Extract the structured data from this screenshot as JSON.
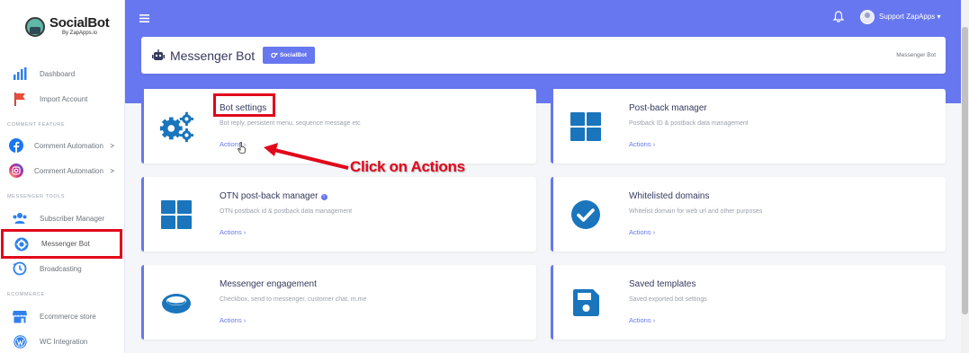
{
  "app": {
    "logo_title": "SocialBot",
    "logo_sub": "By ZapApps.io"
  },
  "sidebar": {
    "items": [
      {
        "label": "Dashboard",
        "icon": "bar-chart-icon"
      },
      {
        "label": "Import Account",
        "icon": "flag-icon"
      },
      {
        "label": "Comment Automation",
        "icon": "facebook-icon",
        "chevron": ">"
      },
      {
        "label": "Comment Automation",
        "icon": "instagram-icon",
        "chevron": ">"
      },
      {
        "label": "Subscriber Manager",
        "icon": "users-icon"
      },
      {
        "label": "Messenger Bot",
        "icon": "gear-icon"
      },
      {
        "label": "Broadcasting",
        "icon": "history-icon"
      },
      {
        "label": "Ecommerce store",
        "icon": "store-icon"
      },
      {
        "label": "WC Integration",
        "icon": "wordpress-icon"
      }
    ],
    "sections": {
      "comment": "COMMENT FEATURE",
      "messenger": "MESSENGER TOOLS",
      "ecommerce": "ECOMMERCE"
    }
  },
  "topbar": {
    "user": "Support ZapApps ▾"
  },
  "header": {
    "title": "Messenger Bot",
    "badge": "SocialBot",
    "breadcrumb": "Messenger Bot"
  },
  "cards": [
    {
      "title": "Bot settings",
      "desc": "Bot reply, persistent menu, sequence message etc",
      "action": "Actions",
      "icon": "gears-icon"
    },
    {
      "title": "Post-back manager",
      "desc": "Postback ID & postback data management",
      "action": "Actions",
      "icon": "grid-icon"
    },
    {
      "title": "OTN post-back manager",
      "desc": "OTN postback id & postback data management",
      "action": "Actions",
      "icon": "grid-icon"
    },
    {
      "title": "Whitelisted domains",
      "desc": "Whitelist domain for web url and other purposes",
      "action": "Actions",
      "icon": "check-circle-icon"
    },
    {
      "title": "Messenger engagement",
      "desc": "Checkbox, send to messenger, customer chat, m.me",
      "action": "Actions",
      "icon": "ring-icon"
    },
    {
      "title": "Saved templates",
      "desc": "Saved exported bot settings",
      "action": "Actions",
      "icon": "save-icon"
    }
  ],
  "annotation": {
    "text": "Click on Actions"
  },
  "colors": {
    "accent": "#6777ef",
    "highlight": "#e1081b",
    "sidebar_icon": "#2f80ed"
  }
}
